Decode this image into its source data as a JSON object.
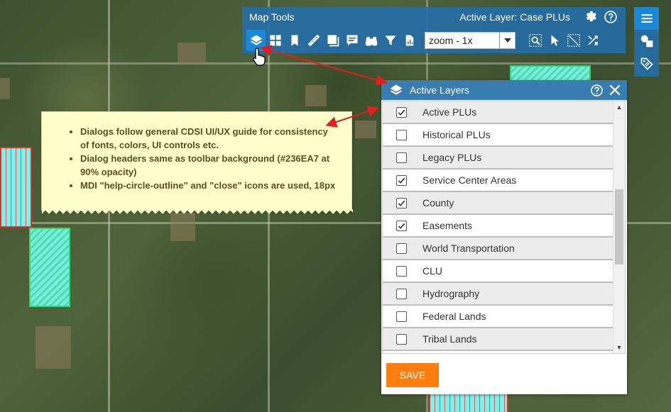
{
  "toolbar": {
    "title": "Map Tools",
    "active_layer": "Active Layer: Case PLUs",
    "zoom_value": "zoom - 1x",
    "icons": [
      "layers-icon",
      "grid-icon",
      "bookmark-icon",
      "ruler-icon",
      "print-icon",
      "comment-icon",
      "binoculars-icon",
      "filter-icon",
      "file-chart-icon",
      "zoom-select-icon",
      "pointer-icon",
      "select-rectangle-icon",
      "shuffle-icon"
    ]
  },
  "note": {
    "items": [
      "Dialogs follow general CDSI UI/UX guide for consistency of fonts, colors, UI controls etc.",
      "Dialog headers same as toolbar background (#236EA7 at 90% opacity)",
      "MDI \"help-circle-outline\" and \"close\" icons are used, 18px"
    ]
  },
  "dialog": {
    "title": "Active Layers",
    "save_label": "SAVE",
    "layers": [
      {
        "label": "Active PLUs",
        "checked": true
      },
      {
        "label": "Historical PLUs",
        "checked": false
      },
      {
        "label": "Legacy PLUs",
        "checked": false
      },
      {
        "label": "Service Center Areas",
        "checked": true
      },
      {
        "label": "County",
        "checked": true
      },
      {
        "label": "Easements",
        "checked": true
      },
      {
        "label": "World Transportation",
        "checked": false
      },
      {
        "label": "CLU",
        "checked": false
      },
      {
        "label": "Hydrography",
        "checked": false
      },
      {
        "label": "Federal Lands",
        "checked": false
      },
      {
        "label": "Tribal Lands",
        "checked": false
      }
    ]
  },
  "colors": {
    "header_bg": "#236EA7",
    "save_button": "#FF7D0F",
    "note_bg": "#FFFDC9",
    "arrow": "#E0201E"
  }
}
